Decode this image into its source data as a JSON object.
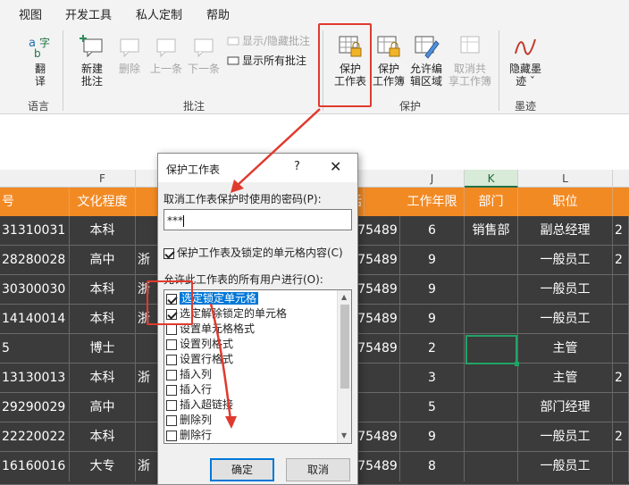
{
  "menu": [
    "视图",
    "开发工具",
    "私人定制",
    "帮助"
  ],
  "ribbon": {
    "translate": {
      "label_line1": "翻",
      "label_line2": "译"
    },
    "group_language": "语言",
    "new_comment": {
      "line1": "新建",
      "line2": "批注"
    },
    "delete": "删除",
    "prev": "上一条",
    "next": "下一条",
    "show_hide_comment": "显示/隐藏批注",
    "show_all_comments": "显示所有批注",
    "group_comment": "批注",
    "protect_sheet": {
      "line1": "保护",
      "line2": "工作表"
    },
    "protect_workbook": {
      "line1": "保护",
      "line2": "工作簿"
    },
    "allow_edit": {
      "line1": "允许编",
      "line2": "辑区域"
    },
    "unshare": {
      "line1": "取消共",
      "line2": "享工作簿"
    },
    "group_protect": "保护",
    "hide_ink": {
      "line1": "隐藏墨",
      "line2": "迹 ˇ"
    },
    "group_ink": "墨迹"
  },
  "columns": [
    "F",
    "J",
    "K",
    "L"
  ],
  "table": {
    "headers": [
      "号",
      "文化程度",
      "话",
      "工作年限",
      "部门",
      "职位"
    ],
    "rows": [
      {
        "id": "31310031",
        "edu": "本科",
        "c": "",
        "phone": "75489",
        "years": "6",
        "dept": "销售部",
        "pos": "副总经理",
        "x": "2"
      },
      {
        "id": "28280028",
        "edu": "高中",
        "c": "浙",
        "phone": "75489",
        "years": "9",
        "dept": "",
        "pos": "一般员工",
        "x": "2"
      },
      {
        "id": "30300030",
        "edu": "本科",
        "c": "浙",
        "phone": "75489",
        "years": "9",
        "dept": "",
        "pos": "一般员工",
        "x": ""
      },
      {
        "id": "14140014",
        "edu": "本科",
        "c": "浙",
        "phone": "75489",
        "years": "9",
        "dept": "",
        "pos": "一般员工",
        "x": ""
      },
      {
        "id": "5",
        "edu": "博士",
        "c": "",
        "phone": "75489",
        "years": "2",
        "dept": "",
        "pos": "主管",
        "x": ""
      },
      {
        "id": "13130013",
        "edu": "本科",
        "c": "浙",
        "phone": "",
        "years": "3",
        "dept": "",
        "pos": "主管",
        "x": "2"
      },
      {
        "id": "29290029",
        "edu": "高中",
        "c": "",
        "phone": "",
        "years": "5",
        "dept": "",
        "pos": "部门经理",
        "x": ""
      },
      {
        "id": "22220022",
        "edu": "本科",
        "c": "",
        "phone": "75489",
        "years": "9",
        "dept": "",
        "pos": "一般员工",
        "x": "2"
      },
      {
        "id": "16160016",
        "edu": "大专",
        "c": "浙",
        "phone": "75489",
        "years": "8",
        "dept": "",
        "pos": "一般员工",
        "x": ""
      }
    ]
  },
  "dialog": {
    "title": "保护工作表",
    "help": "?",
    "close": "✕",
    "password_label": "取消工作表保护时使用的密码(P):",
    "password_value": "***",
    "protect_checkbox": "保护工作表及锁定的单元格内容(C)",
    "allow_label": "允许此工作表的所有用户进行(O):",
    "options": [
      {
        "label": "选定锁定单元格",
        "checked": true
      },
      {
        "label": "选定解除锁定的单元格",
        "checked": true
      },
      {
        "label": "设置单元格格式",
        "checked": false
      },
      {
        "label": "设置列格式",
        "checked": false
      },
      {
        "label": "设置行格式",
        "checked": false
      },
      {
        "label": "插入列",
        "checked": false
      },
      {
        "label": "插入行",
        "checked": false
      },
      {
        "label": "插入超链接",
        "checked": false
      },
      {
        "label": "删除列",
        "checked": false
      },
      {
        "label": "删除行",
        "checked": false
      }
    ],
    "ok": "确定",
    "cancel": "取消"
  },
  "colors": {
    "header_orange": "#f28a24",
    "row_dark": "#3b3b3b",
    "annotation_red": "#e03a2e",
    "selection_green": "#21a366"
  }
}
